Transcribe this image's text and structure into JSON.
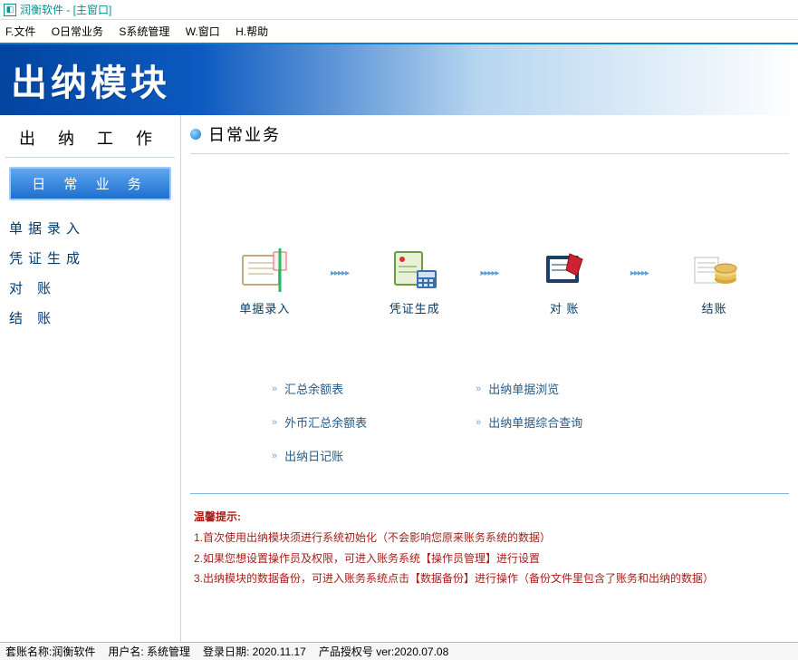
{
  "window": {
    "title": "润衡软件 - [主窗口]"
  },
  "menu": {
    "file": "F.文件",
    "daily": "O日常业务",
    "system": "S系统管理",
    "window": "W.窗口",
    "help": "H.帮助"
  },
  "banner": {
    "text": "出纳模块"
  },
  "sidebar": {
    "header": "出 纳 工 作",
    "selected": "日 常 业 务",
    "items": [
      {
        "label": "单据录入"
      },
      {
        "label": "凭证生成"
      },
      {
        "label": "对    账"
      },
      {
        "label": "结    账"
      }
    ]
  },
  "main": {
    "title": "日常业务",
    "flow": [
      {
        "label": "单据录入"
      },
      {
        "label": "凭证生成"
      },
      {
        "label": "对  账"
      },
      {
        "label": "结账"
      }
    ],
    "links_left": [
      {
        "label": "汇总余额表"
      },
      {
        "label": "外币汇总余额表"
      },
      {
        "label": "出纳日记账"
      }
    ],
    "links_right": [
      {
        "label": "出纳单据浏览"
      },
      {
        "label": "出纳单据综合查询"
      }
    ],
    "tips": {
      "title": "温馨提示:",
      "line1": "1.首次使用出纳模块须进行系统初始化（不会影响您原来账务系统的数据）",
      "line2": "2.如果您想设置操作员及权限，可进入账务系统【操作员管理】进行设置",
      "line3": "3.出纳模块的数据备份，可进入账务系统点击【数据备份】进行操作（备份文件里包含了账务和出纳的数据）"
    }
  },
  "status": {
    "account": "套账名称:润衡软件",
    "user": "用户名: 系统管理",
    "login_date": "登录日期: 2020.11.17",
    "license": "产品授权号  ver:2020.07.08"
  }
}
